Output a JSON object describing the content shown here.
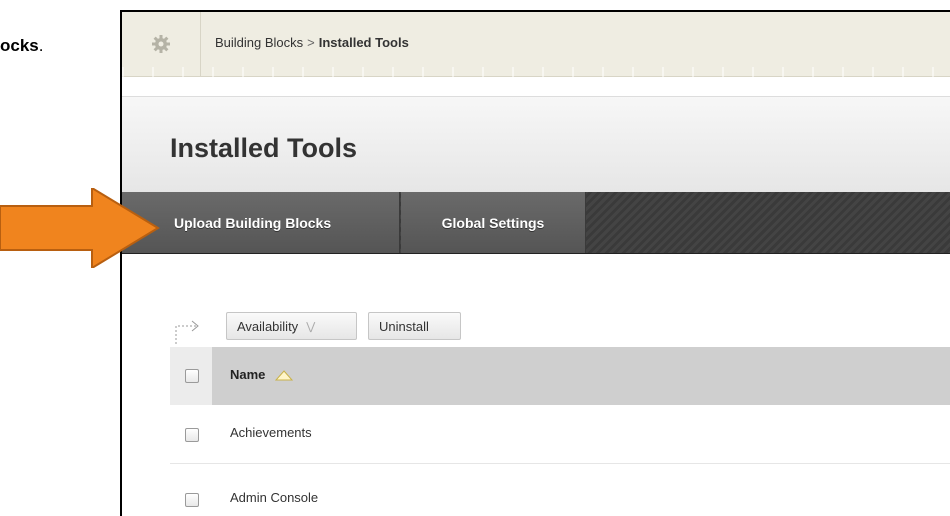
{
  "doc": {
    "text_bold": "ocks",
    "text_tail": "."
  },
  "breadcrumb": {
    "items": [
      "Building Blocks",
      "Installed Tools"
    ],
    "separator": ">",
    "gear_icon": "gear-icon"
  },
  "page": {
    "title": "Installed Tools"
  },
  "action_bar": {
    "buttons": [
      "Upload Building Blocks",
      "Global Settings"
    ]
  },
  "list_actions": {
    "availability_label": "Availability",
    "availability_icon": "chevron-down-double-icon",
    "uninstall_label": "Uninstall"
  },
  "table": {
    "header": {
      "name_label": "Name",
      "sort_icon": "sort-ascending-icon"
    },
    "rows": [
      {
        "name": "Achievements"
      },
      {
        "name": "Admin Console"
      }
    ]
  },
  "annotation": {
    "arrow_color": "#f0841e"
  }
}
